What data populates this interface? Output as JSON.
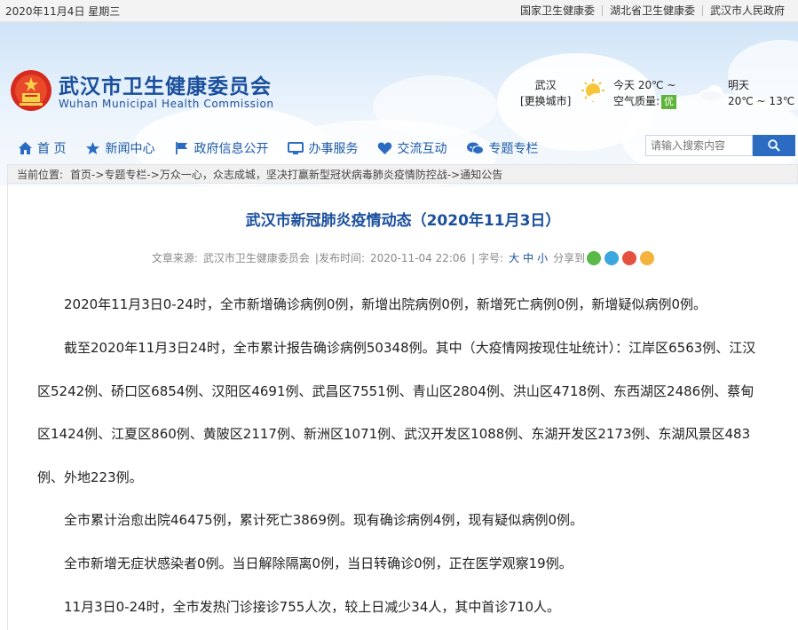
{
  "topbar": {
    "date": "2020年11月4日 星期三",
    "links": [
      "国家卫生健康委",
      "湖北省卫生健康委",
      "武汉市人民政府"
    ]
  },
  "header": {
    "brand_cn": "武汉市卫生健康委员会",
    "brand_en": "Wuhan Municipal Health Commission",
    "weather": {
      "city": "武汉",
      "change_city": "[更换城市]",
      "today_label": "今天 20℃ ~",
      "aqi_label": "空气质量:",
      "aqi_value": "优",
      "tomorrow_label": "明天",
      "tomorrow_temp": "20℃ ~ 13℃"
    }
  },
  "nav": {
    "items": [
      {
        "label": "首 页",
        "icon": "home-icon"
      },
      {
        "label": "新闻中心",
        "icon": "star-icon"
      },
      {
        "label": "政府信息公开",
        "icon": "flag-icon"
      },
      {
        "label": "办事服务",
        "icon": "monitor-icon"
      },
      {
        "label": "交流互动",
        "icon": "heart-icon"
      },
      {
        "label": "专题专栏",
        "icon": "chat-icon"
      }
    ],
    "search_placeholder": "请输入搜索内容"
  },
  "breadcrumb": {
    "prefix": "当前位置:",
    "path": "首页->专题专栏->万众一心，众志成城，坚决打赢新型冠状病毒肺炎疫情防控战->通知公告"
  },
  "article": {
    "title": "武汉市新冠肺炎疫情动态（2020年11月3日）",
    "meta": {
      "source_label": "文章来源:",
      "source": "武汉市卫生健康委员会",
      "time_label": "|发布时间:",
      "time": "2020-11-04 22:06",
      "font_label": "| 字号:",
      "size_large": "大",
      "size_mid": "中",
      "size_small": "小",
      "share_label": "分享到"
    },
    "paragraphs": [
      "2020年11月3日0-24时，全市新增确诊病例0例，新增出院病例0例，新增死亡病例0例，新增疑似病例0例。",
      "截至2020年11月3日24时，全市累计报告确诊病例50348例。其中（大疫情网按现住址统计）：江岸区6563例、江汉区5242例、硚口区6854例、汉阳区4691例、武昌区7551例、青山区2804例、洪山区4718例、东西湖区2486例、蔡甸区1424例、江夏区860例、黄陂区2117例、新洲区1071例、武汉开发区1088例、东湖开发区2173例、东湖风景区483例、外地223例。",
      "全市累计治愈出院46475例，累计死亡3869例。现有确诊病例4例，现有疑似病例0例。",
      "全市新增无症状感染者0例。当日解除隔离0例，当日转确诊0例，正在医学观察19例。",
      "11月3日0-24时，全市发热门诊接诊755人次，较上日减少34人，其中首诊710人。"
    ]
  },
  "colors": {
    "brand": "#1a4f9c",
    "nav": "#1d5aa8",
    "search_button": "#2b6cc2",
    "aqi_good": "#5fb336"
  }
}
